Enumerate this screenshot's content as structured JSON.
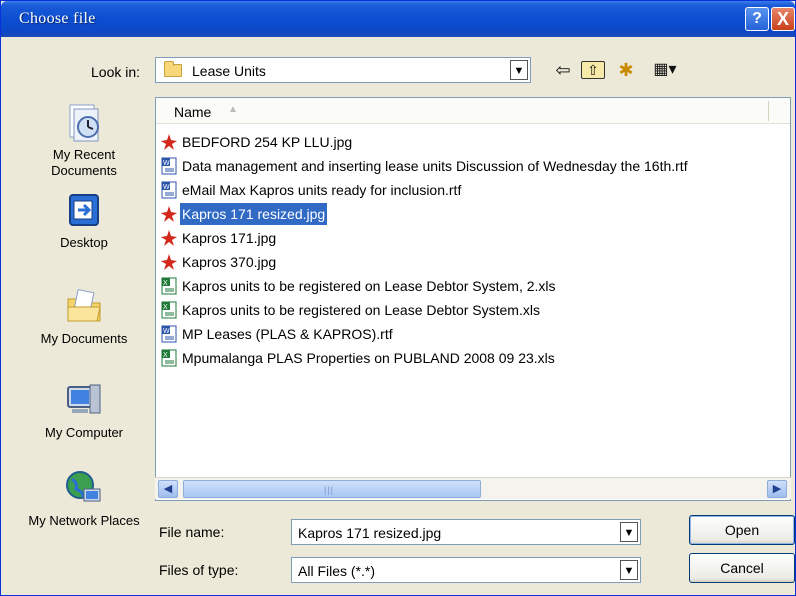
{
  "window": {
    "title": "Choose file",
    "help_glyph": "?",
    "close_glyph": "X"
  },
  "look_in": {
    "label": "Look in:",
    "value": "Lease Units",
    "arrow": "▼"
  },
  "toolbar": {
    "back_glyph": "⇦",
    "up_glyph": "⇧",
    "new_folder_glyph": "✱",
    "views_glyph": "▦▾"
  },
  "places": [
    {
      "label": "My Recent Documents",
      "icon": "recent-documents-icon"
    },
    {
      "label": "Desktop",
      "icon": "desktop-icon"
    },
    {
      "label": "My Documents",
      "icon": "my-documents-icon"
    },
    {
      "label": "My Computer",
      "icon": "my-computer-icon"
    },
    {
      "label": "My Network Places",
      "icon": "network-places-icon"
    }
  ],
  "file_list": {
    "column_header": "Name",
    "sort_glyph": "▲",
    "files": [
      {
        "name": "BEDFORD 254 KP LLU.jpg",
        "type": "jpg"
      },
      {
        "name": "Data management and inserting lease units Discussion of Wednesday the 16th.rtf",
        "type": "rtf"
      },
      {
        "name": "eMail Max Kapros units ready for inclusion.rtf",
        "type": "rtf"
      },
      {
        "name": "Kapros 171 resized.jpg",
        "type": "jpg",
        "selected": true
      },
      {
        "name": "Kapros 171.jpg",
        "type": "jpg"
      },
      {
        "name": "Kapros 370.jpg",
        "type": "jpg"
      },
      {
        "name": "Kapros units to be registered on Lease Debtor System, 2.xls",
        "type": "xls"
      },
      {
        "name": "Kapros units to be registered on Lease Debtor System.xls",
        "type": "xls"
      },
      {
        "name": "MP Leases (PLAS & KAPROS).rtf",
        "type": "rtf"
      },
      {
        "name": "Mpumalanga PLAS Properties on PUBLAND 2008 09 23.xls",
        "type": "xls"
      }
    ]
  },
  "scrollbar": {
    "left_glyph": "◀",
    "right_glyph": "▶",
    "grip": "|||"
  },
  "file_name": {
    "label": "File name:",
    "value": "Kapros 171 resized.jpg"
  },
  "files_of_type": {
    "label": "Files of type:",
    "value": "All Files (*.*)"
  },
  "buttons": {
    "open": "Open",
    "cancel": "Cancel"
  },
  "colors": {
    "selection": "#316ac5",
    "titlebar": "#0b4fd2"
  }
}
